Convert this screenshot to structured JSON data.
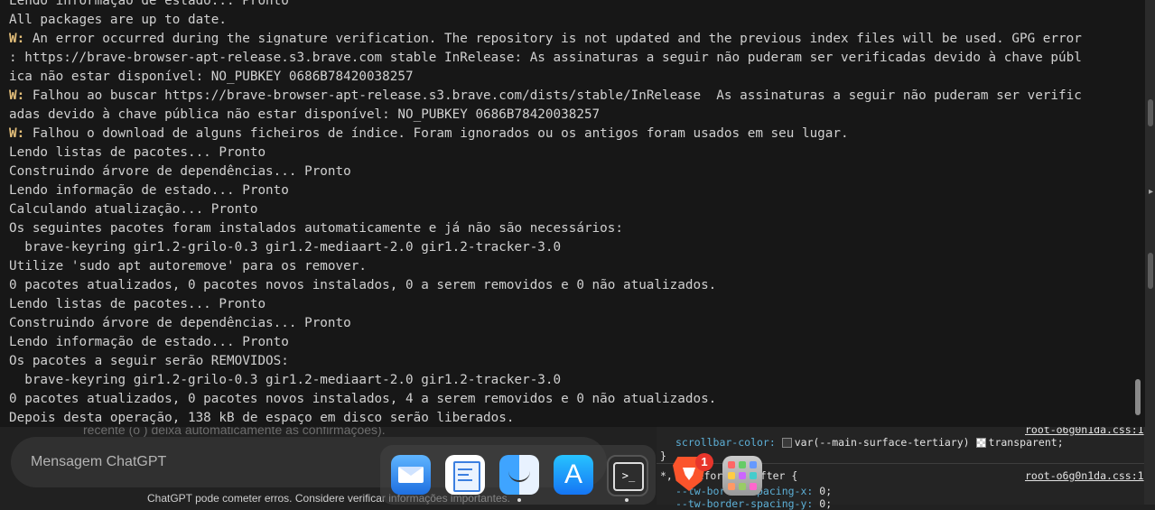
{
  "chatgpt": {
    "faded_line": "recente (o  ) deixa automaticamente as confirmações).",
    "input_placeholder": "Mensagem ChatGPT",
    "disclaimer": "ChatGPT pode cometer erros. Considere verificar informações importantes."
  },
  "devtools": {
    "rule1_link": "root-o6g0n1da.css:1",
    "rule1_prop": "scrollbar-color:",
    "rule1_value_a": "var(--main-surface-tertiary)",
    "rule1_value_b": "transparent;",
    "rule1_close": "}",
    "rule2_selector": "*, ::before, ::after {",
    "rule2_link": "root-o6g0n1da.css:1",
    "rule2_prop_a": "--tw-border-spacing-x:",
    "rule2_val_a": "0;",
    "rule2_prop_b": "--tw-border-spacing-y:",
    "rule2_val_b": "0;"
  },
  "terminal": {
    "lines": [
      {
        "prefix": "",
        "text": "Lendo informação de estado... Pronto"
      },
      {
        "prefix": "",
        "text": "All packages are up to date."
      },
      {
        "prefix": "W:",
        "text": " An error occurred during the signature verification. The repository is not updated and the previous index files will be used. GPG error"
      },
      {
        "prefix": "",
        "text": ": https://brave-browser-apt-release.s3.brave.com stable InRelease: As assinaturas a seguir não puderam ser verificadas devido à chave públ"
      },
      {
        "prefix": "",
        "text": "ica não estar disponível: NO_PUBKEY 0686B78420038257"
      },
      {
        "prefix": "W:",
        "text": " Falhou ao buscar https://brave-browser-apt-release.s3.brave.com/dists/stable/InRelease  As assinaturas a seguir não puderam ser verific"
      },
      {
        "prefix": "",
        "text": "adas devido à chave pública não estar disponível: NO_PUBKEY 0686B78420038257"
      },
      {
        "prefix": "W:",
        "text": " Falhou o download de alguns ficheiros de índice. Foram ignorados ou os antigos foram usados em seu lugar."
      },
      {
        "prefix": "",
        "text": "Lendo listas de pacotes... Pronto"
      },
      {
        "prefix": "",
        "text": "Construindo árvore de dependências... Pronto"
      },
      {
        "prefix": "",
        "text": "Lendo informação de estado... Pronto"
      },
      {
        "prefix": "",
        "text": "Calculando atualização... Pronto"
      },
      {
        "prefix": "",
        "text": "Os seguintes pacotes foram instalados automaticamente e já não são necessários:"
      },
      {
        "prefix": "",
        "text": "  brave-keyring gir1.2-grilo-0.3 gir1.2-mediaart-2.0 gir1.2-tracker-3.0"
      },
      {
        "prefix": "",
        "text": "Utilize 'sudo apt autoremove' para os remover."
      },
      {
        "prefix": "",
        "text": "0 pacotes atualizados, 0 pacotes novos instalados, 0 a serem removidos e 0 não atualizados."
      },
      {
        "prefix": "",
        "text": "Lendo listas de pacotes... Pronto"
      },
      {
        "prefix": "",
        "text": "Construindo árvore de dependências... Pronto"
      },
      {
        "prefix": "",
        "text": "Lendo informação de estado... Pronto"
      },
      {
        "prefix": "",
        "text": "Os pacotes a seguir serão REMOVIDOS:"
      },
      {
        "prefix": "",
        "text": "  brave-keyring gir1.2-grilo-0.3 gir1.2-mediaart-2.0 gir1.2-tracker-3.0"
      },
      {
        "prefix": "",
        "text": "0 pacotes atualizados, 0 pacotes novos instalados, 4 a serem removidos e 0 não atualizados."
      },
      {
        "prefix": "",
        "text": "Depois desta operação, 138 kB de espaço em disco serão liberados."
      }
    ]
  },
  "dock": {
    "items": [
      {
        "name": "mail-icon"
      },
      {
        "name": "textedit-icon"
      },
      {
        "name": "finder-icon"
      },
      {
        "name": "app-store-icon"
      },
      {
        "name": "terminal-icon",
        "glyph": ">_"
      },
      {
        "name": "brave-icon",
        "badge": "1"
      },
      {
        "name": "launchpad-icon"
      }
    ]
  }
}
